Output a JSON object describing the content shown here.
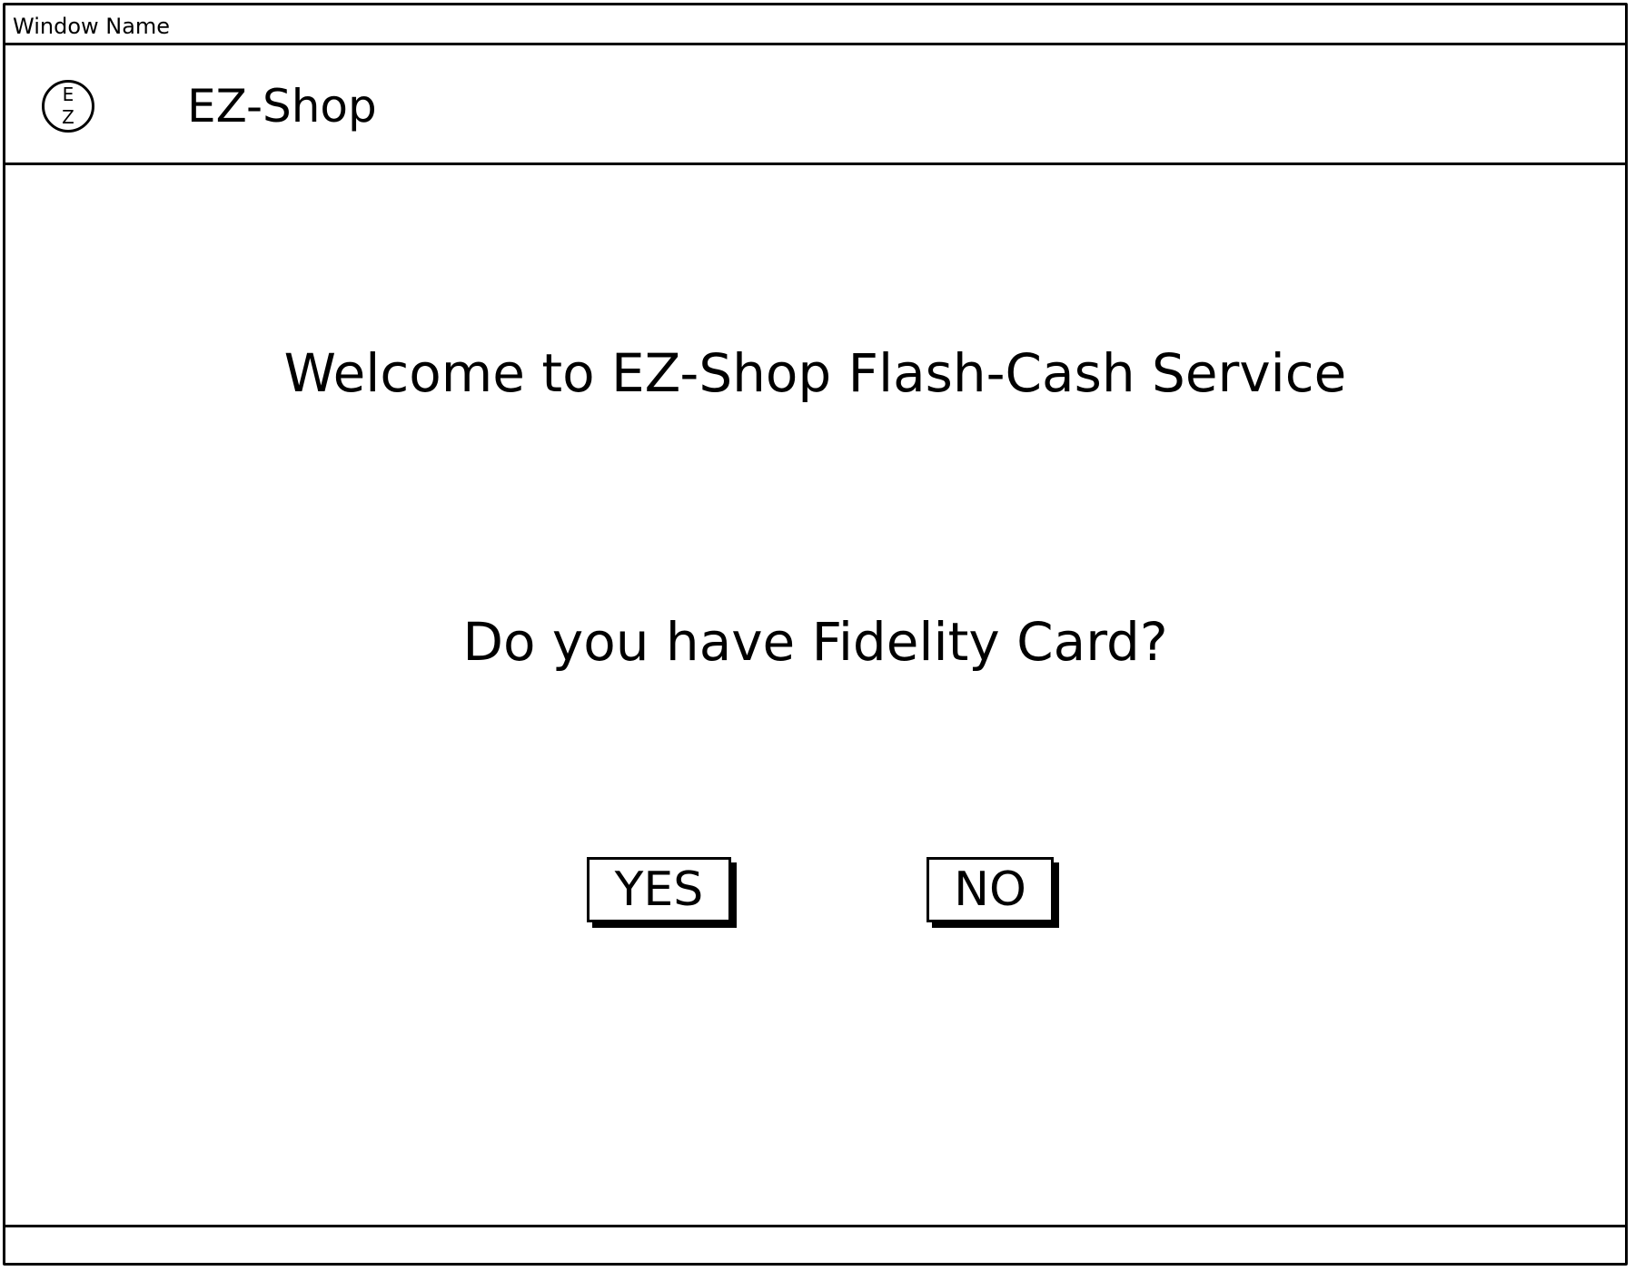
{
  "window": {
    "title": "Window Name"
  },
  "header": {
    "logo_top_letter": "E",
    "logo_bottom_letter": "Z",
    "app_title": "EZ-Shop"
  },
  "main": {
    "welcome_text": "Welcome to EZ-Shop Flash-Cash Service",
    "question_text": "Do you have Fidelity Card?",
    "yes_label": "YES",
    "no_label": "NO"
  },
  "colors": {
    "line": "#000000",
    "background": "#ffffff"
  }
}
